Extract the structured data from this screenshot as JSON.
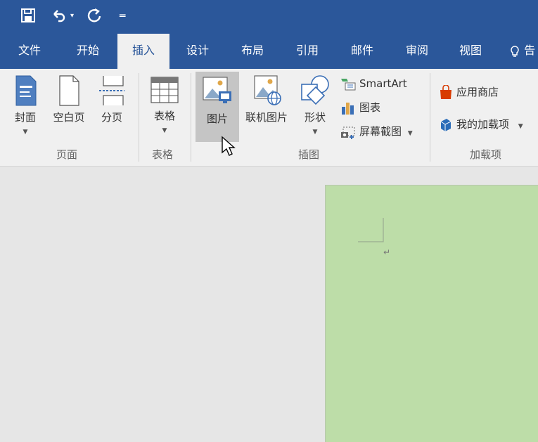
{
  "quick_access": {
    "save_icon": "save-icon",
    "undo_icon": "undo-icon",
    "undo_dropdown_icon": "chevron-down-icon",
    "redo_icon": "redo-icon",
    "customize_icon": "customize-quick-access-icon"
  },
  "tabs": [
    {
      "label": "文件"
    },
    {
      "label": "开始"
    },
    {
      "label": "插入"
    },
    {
      "label": "设计"
    },
    {
      "label": "布局"
    },
    {
      "label": "引用"
    },
    {
      "label": "邮件"
    },
    {
      "label": "审阅"
    },
    {
      "label": "视图"
    },
    {
      "label": "告"
    }
  ],
  "active_tab": "插入",
  "ribbon": {
    "pages": {
      "cover_label": "封面",
      "blank_label": "空白页",
      "break_label": "分页",
      "group_label": "页面"
    },
    "tables": {
      "table_label": "表格",
      "group_label": "表格"
    },
    "illustrations": {
      "picture_label": "图片",
      "online_picture_label": "联机图片",
      "shapes_label": "形状",
      "smartart_label": "SmartArt",
      "chart_label": "图表",
      "screenshot_label": "屏幕截图",
      "group_label": "插图"
    },
    "addins": {
      "store_label": "应用商店",
      "myaddins_label": "我的加载项",
      "group_label": "加载项"
    }
  },
  "document": {
    "paragraph_mark": "↵"
  },
  "colors": {
    "title_bar": "#2b579a",
    "ribbon_bg": "#f0f0f0",
    "page_bg": "#bddda8",
    "canvas_bg": "#e6e6e6"
  }
}
